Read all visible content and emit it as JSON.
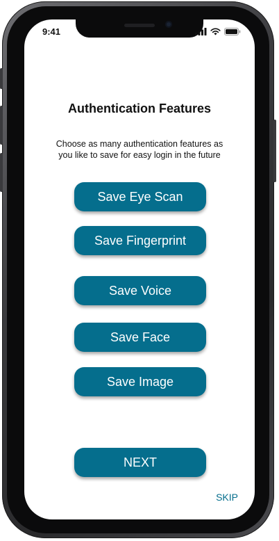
{
  "status_bar": {
    "time": "9:41",
    "icons": [
      "cellular-signal-icon",
      "wifi-icon",
      "battery-icon"
    ]
  },
  "header": {
    "title": "Authentication Features",
    "description_line1": "Choose as many authentication features as",
    "description_line2": "you like to save for easy login in the future"
  },
  "options": {
    "eye_scan": "Save Eye Scan",
    "fingerprint": "Save Fingerprint",
    "voice": "Save Voice",
    "face": "Save Face",
    "image": "Save Image"
  },
  "footer": {
    "next_label": "NEXT",
    "skip_label": "SKIP"
  },
  "colors": {
    "accent": "#056e8d",
    "button_text": "#ffffff",
    "background": "#ffffff"
  }
}
